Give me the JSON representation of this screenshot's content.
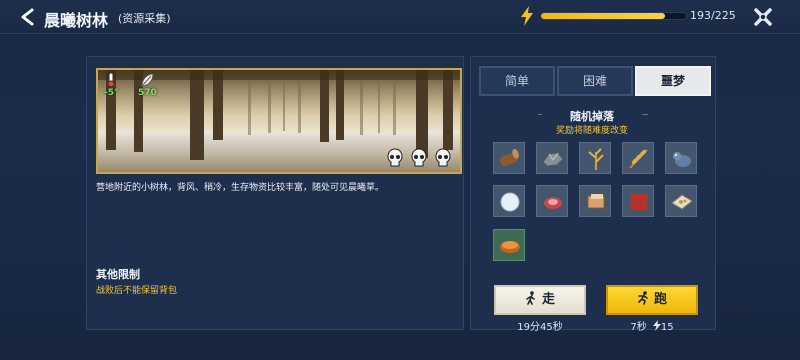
{
  "header": {
    "title": "晨曦树林",
    "subtitle": "(资源采集)",
    "energy_text": "193/225",
    "energy_fraction": 0.858
  },
  "scene": {
    "temperature": "-5°",
    "resource_value": "570",
    "danger_icons": [
      "skull-icon",
      "skull-icon",
      "skull-icon"
    ]
  },
  "description": "营地附近的小树林，背风、稍冷，生存物资比较丰富，随处可见晨曦草。",
  "restrictions": {
    "title": "其他限制",
    "text": "战败后不能保留背包"
  },
  "tabs": [
    {
      "label": "简单",
      "active": false
    },
    {
      "label": "困难",
      "active": false
    },
    {
      "label": "噩梦",
      "active": true
    }
  ],
  "drops": {
    "title": "随机掉落",
    "subtitle": "奖励将随难度改变",
    "items": [
      {
        "icon": "wood-log-icon"
      },
      {
        "icon": "metal-ore-icon"
      },
      {
        "icon": "herb-sprout-icon"
      },
      {
        "icon": "wheat-branch-icon"
      },
      {
        "icon": "blue-creature-icon"
      },
      {
        "icon": "snowball-icon"
      },
      {
        "icon": "raw-meat-icon"
      },
      {
        "icon": "leather-block-icon"
      },
      {
        "icon": "red-clover-icon"
      },
      {
        "icon": "pan-food-icon"
      },
      {
        "icon": "pie-food-icon",
        "highlight": true
      }
    ]
  },
  "actions": {
    "walk_label": "走",
    "walk_time": "19分45秒",
    "run_label": "跑",
    "run_time": "7秒",
    "run_cost": "15"
  },
  "colors": {
    "accent_gold": "#f2c53a",
    "energy_fill": "#f0b81a",
    "run_button": "#ffd735",
    "panel_bg": "#1d2f4c"
  }
}
